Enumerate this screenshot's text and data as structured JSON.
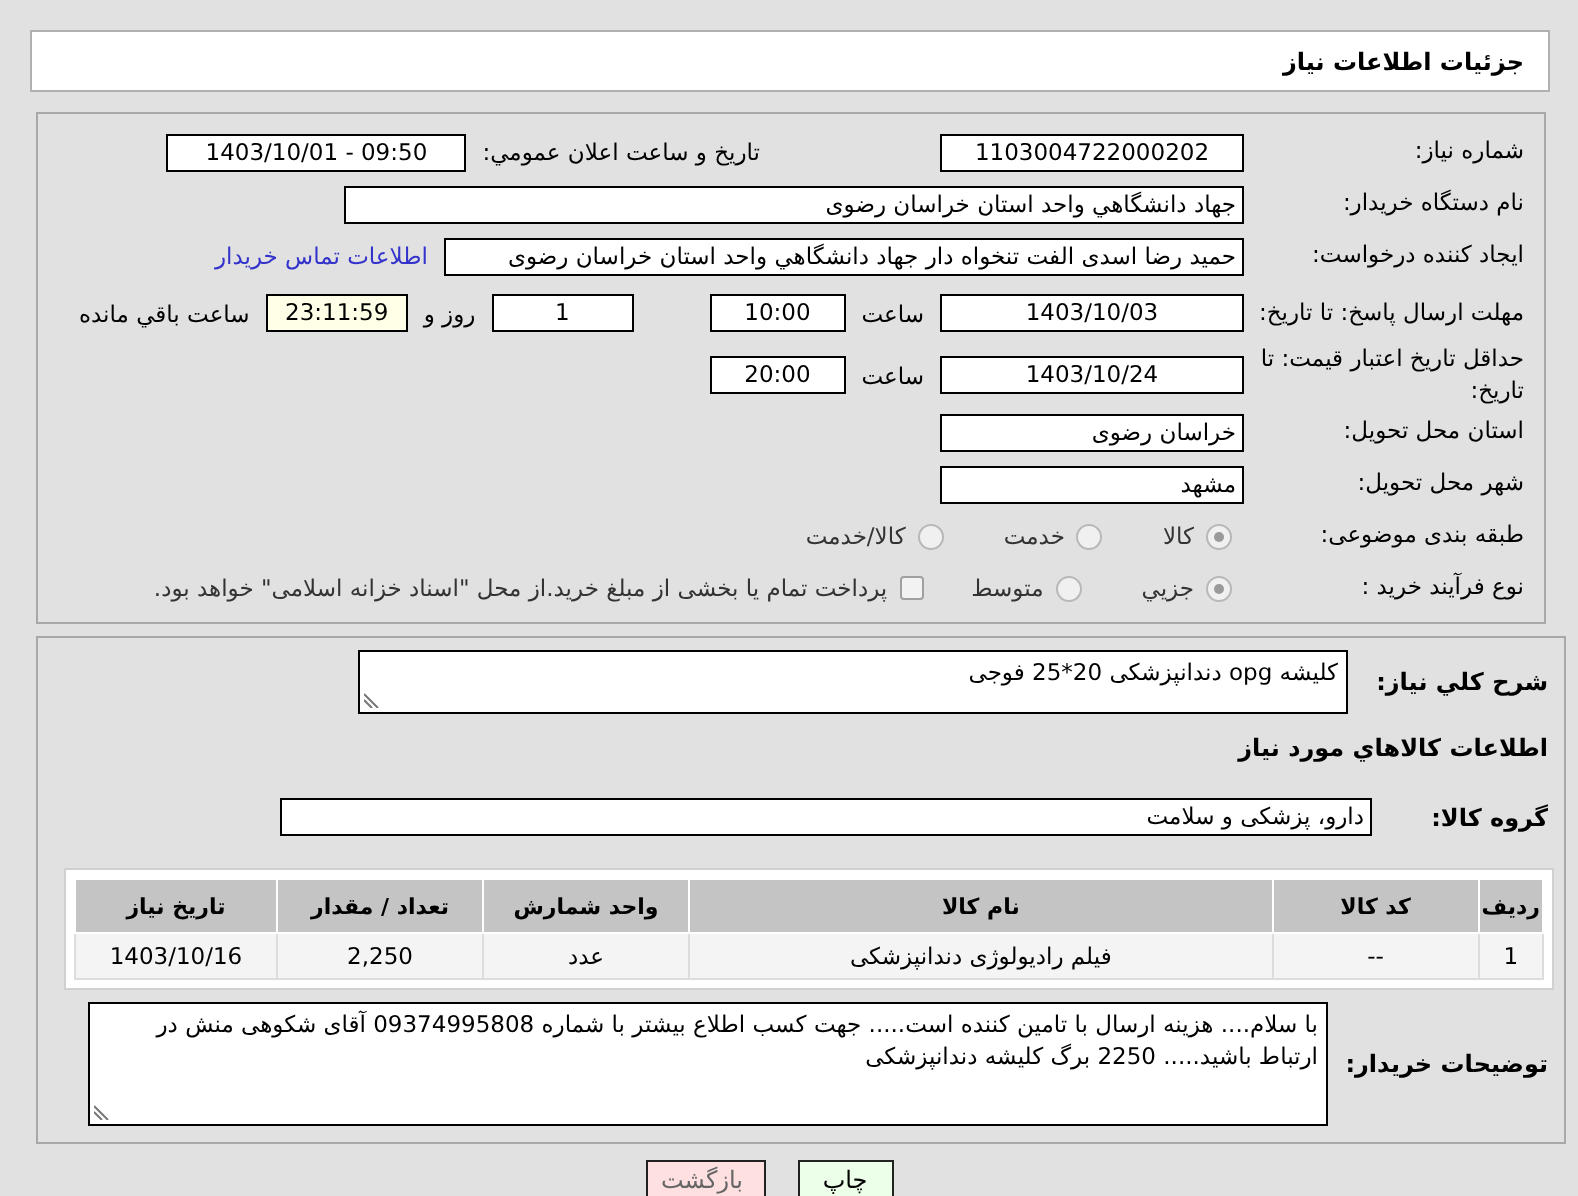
{
  "header": {
    "title": "جزئیات اطلاعات نیاز"
  },
  "details": {
    "need_number": {
      "label": "شماره نیاز:",
      "value": "1103004722000202"
    },
    "announce": {
      "label": "تاریخ و ساعت اعلان عمومي:",
      "value": "1403/10/01 - 09:50"
    },
    "buyer_org": {
      "label": "نام دستگاه خریدار:",
      "value": "جهاد دانشگاهي واحد استان خراسان رضوی"
    },
    "requester": {
      "label": "ایجاد کننده درخواست:",
      "value": "حمید رضا اسدی الفت تنخواه دار جهاد دانشگاهي واحد استان خراسان رضوی",
      "link": "اطلاعات تماس خریدار"
    },
    "deadline": {
      "label": "مهلت ارسال پاسخ: تا تاریخ:",
      "date": "1403/10/03",
      "time_label": "ساعت",
      "time": "10:00",
      "days": "1",
      "days_label": "روز و",
      "remaining": "23:11:59",
      "remaining_label": "ساعت باقي مانده"
    },
    "validity": {
      "label": "حداقل تاریخ اعتبار قیمت: تا تاریخ:",
      "date": "1403/10/24",
      "time_label": "ساعت",
      "time": "20:00"
    },
    "province": {
      "label": "استان محل تحویل:",
      "value": "خراسان رضوی"
    },
    "city": {
      "label": "شهر محل تحویل:",
      "value": "مشهد"
    },
    "category": {
      "label": "طبقه بندی موضوعی:",
      "options": [
        {
          "label": "کالا",
          "selected": true
        },
        {
          "label": "خدمت",
          "selected": false
        },
        {
          "label": "کالا/خدمت",
          "selected": false
        }
      ]
    },
    "process": {
      "label": "نوع فرآیند خرید :",
      "options": [
        {
          "label": "جزیي",
          "selected": true
        },
        {
          "label": "متوسط",
          "selected": false
        }
      ],
      "treasury": {
        "checked": false,
        "label": "پرداخت تمام یا بخشی از مبلغ خرید.از محل \"اسناد خزانه اسلامی\" خواهد بود."
      }
    }
  },
  "summary": {
    "label": "شرح کلي نیاز:",
    "value": "کلیشه opg دندانپزشکی 20*25 فوجی"
  },
  "goods_heading": "اطلاعات کالاهاي مورد نیاز",
  "goods_group": {
    "label": "گروه کالا:",
    "value": "دارو، پزشکی و سلامت"
  },
  "table": {
    "columns": [
      "ردیف",
      "کد کالا",
      "نام کالا",
      "واحد شمارش",
      "تعداد / مقدار",
      "تاریخ نیاز"
    ],
    "rows": [
      [
        "1",
        "--",
        "فیلم رادیولوژی دندانپزشکی",
        "عدد",
        "2,250",
        "1403/10/16"
      ]
    ]
  },
  "buyer_notes": {
    "label": "توضیحات خریدار:",
    "value": "با سلام.... هزینه ارسال با تامین کننده است..... جهت کسب اطلاع بیشتر با شماره 09374995808 آقای شکوهی منش در ارتباط باشید..... 2250 برگ کلیشه دندانپزشکی"
  },
  "buttons": [
    {
      "label": "چاپ",
      "kind": "print"
    },
    {
      "label": "بازگشت",
      "kind": "back"
    }
  ]
}
